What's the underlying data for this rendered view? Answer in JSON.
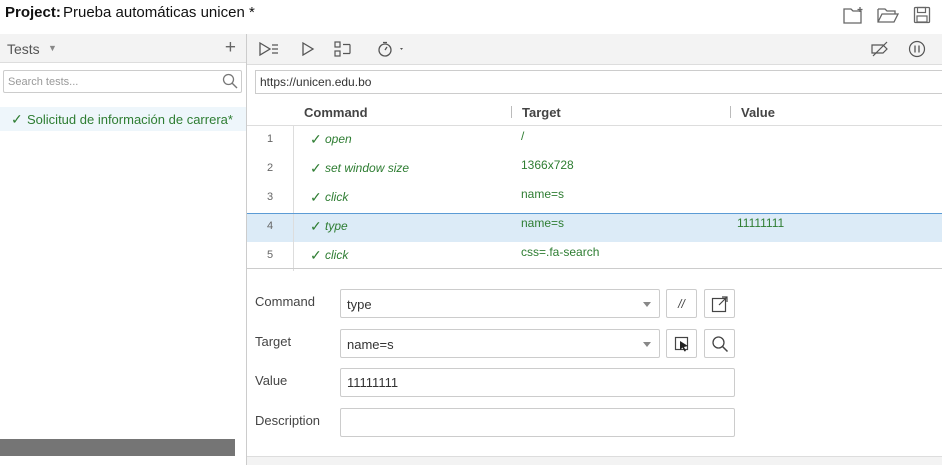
{
  "header": {
    "project_label": "Project:",
    "project_name": "Prueba automáticas unicen",
    "unsaved_marker": " *",
    "icons": [
      "new-project-icon",
      "open-folder-icon",
      "save-icon"
    ]
  },
  "sidebar": {
    "title": "Tests",
    "search_placeholder": "Search tests...",
    "tests": [
      {
        "name": "Solicitud de información de carrera*",
        "status": "✓"
      }
    ]
  },
  "toolbar": {
    "icons": [
      "run-all-tests-icon",
      "run-current-test-icon",
      "step-over-icon",
      "test-execution-speed-icon",
      "disable-breakpoints-icon",
      "pause-on-exceptions-icon"
    ]
  },
  "url": {
    "value": "https://unicen.edu.bo"
  },
  "table": {
    "headers": {
      "command": "Command",
      "target": "Target",
      "value": "Value"
    },
    "rows": [
      {
        "num": "1",
        "status": "✓",
        "command": "open",
        "target": "/",
        "value": ""
      },
      {
        "num": "2",
        "status": "✓",
        "command": "set window size",
        "target": "1366x728",
        "value": ""
      },
      {
        "num": "3",
        "status": "✓",
        "command": "click",
        "target": "name=s",
        "value": ""
      },
      {
        "num": "4",
        "status": "✓",
        "command": "type",
        "target": "name=s",
        "value": "11111111"
      },
      {
        "num": "5",
        "status": "✓",
        "command": "click",
        "target": "css=.fa-search",
        "value": ""
      }
    ],
    "selected_row": 4
  },
  "detail": {
    "command_label": "Command",
    "command_value": "type",
    "comment_button": "//",
    "target_label": "Target",
    "target_value": "name=s",
    "value_label": "Value",
    "value_value": "11111111",
    "description_label": "Description",
    "description_value": ""
  },
  "colors": {
    "success": "#2e7d32",
    "selected_row_bg": "#dcebf7",
    "selected_row_border": "#5b9bd5",
    "scrollbar": "#757575"
  }
}
